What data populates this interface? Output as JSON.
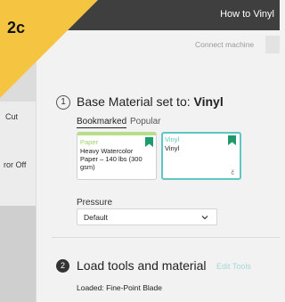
{
  "header": {
    "title": "How to Vinyl",
    "connect_label": "Connect machine"
  },
  "sidebar": {
    "items": [
      {
        "label": "Cut"
      },
      {
        "label": "ror Off"
      }
    ]
  },
  "corner_badge": {
    "label": "2c",
    "color": "#f5c542"
  },
  "step1": {
    "number": "1",
    "title_prefix": "Base Material set to:",
    "title_value": "Vinyl",
    "tabs": [
      {
        "label": "Bookmarked",
        "active": true
      },
      {
        "label": "Popular",
        "active": false
      }
    ],
    "cards": [
      {
        "category": "Paper",
        "name": "Heavy Watercolor Paper – 140 lbs (300 gsm)",
        "bookmarked": true,
        "selected": false,
        "accent": "#9bd36d"
      },
      {
        "category": "Vinyl",
        "name": "Vinyl",
        "bookmarked": true,
        "selected": true,
        "accent": "#5fc7c3",
        "corner_mark": "č"
      }
    ],
    "pressure": {
      "label": "Pressure",
      "value": "Default"
    }
  },
  "step2": {
    "number": "2",
    "title": "Load tools and material",
    "edit_link": "Edit Tools",
    "loaded_label": "Loaded:",
    "loaded_value": "Fine-Point Blade"
  },
  "colors": {
    "topbar": "#3f3f3f",
    "bookmark": "#1f9a6b",
    "accent_teal": "#5fc7c3"
  }
}
